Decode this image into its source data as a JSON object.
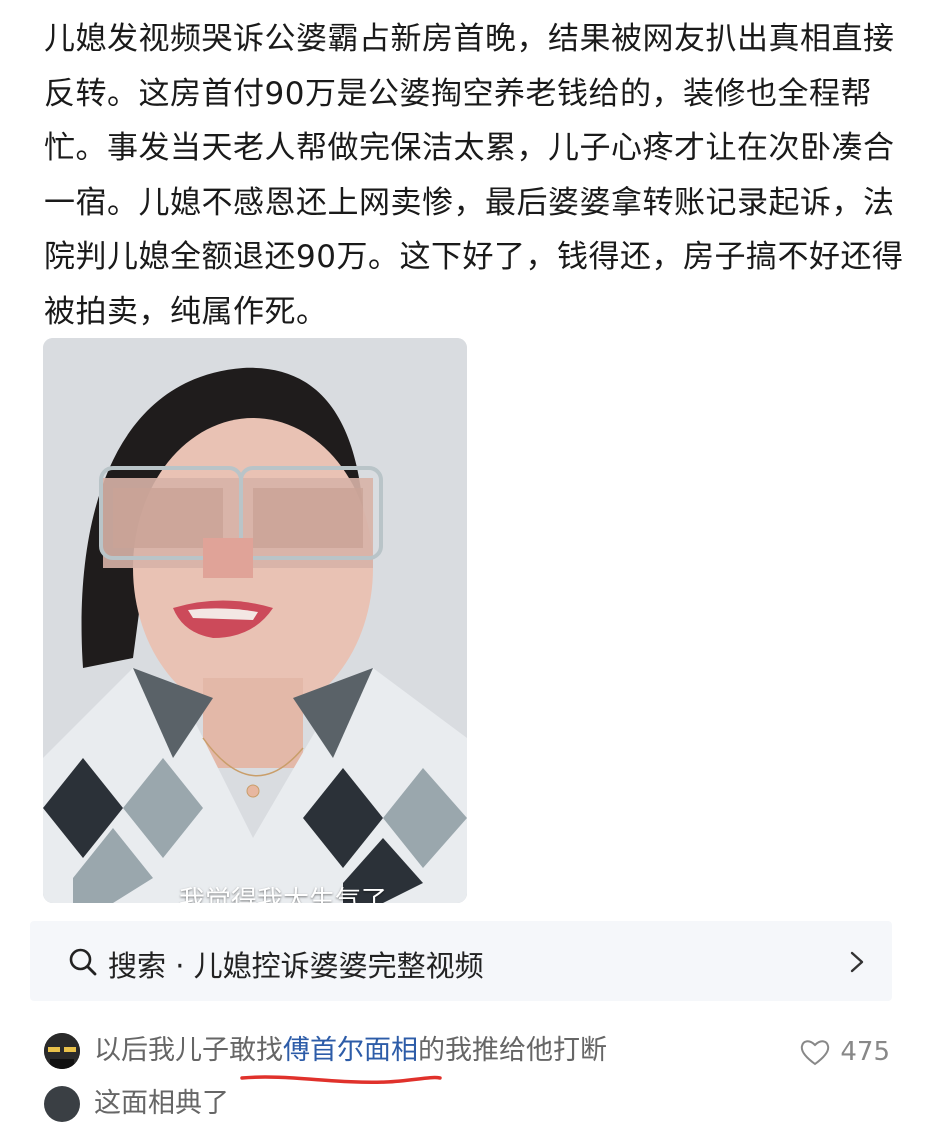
{
  "post": {
    "text": "儿媳发视频哭诉公婆霸占新房首晚，结果被网友扒出真相直接反转。这房首付90万是公婆掏空养老钱给的，装修也全程帮忙。事发当天老人帮做完保洁太累，儿子心疼才让在次卧凑合一宿。儿媳不感恩还上网卖惨，最后婆婆拿转账记录起诉，法院判儿媳全额退还90万。这下好了，钱得还，房子搞不好还得被拍卖，纯属作死。"
  },
  "video": {
    "subtitle": "我觉得我太生气了"
  },
  "search": {
    "label": "搜索 · 儿媳控诉婆婆完整视频",
    "icon": "search-icon",
    "chevron": "chevron-right-icon"
  },
  "comments": [
    {
      "prefix": "以后我儿子敢找",
      "highlight": "傅首尔面相",
      "suffix": "的我推给他打断",
      "likes": "475"
    },
    {
      "prefix": "这面相典了",
      "highlight": "",
      "suffix": "",
      "likes": ""
    }
  ],
  "colors": {
    "link": "#2d5ca8",
    "underline": "#e0312b",
    "search_bg": "#f5f7fa"
  }
}
